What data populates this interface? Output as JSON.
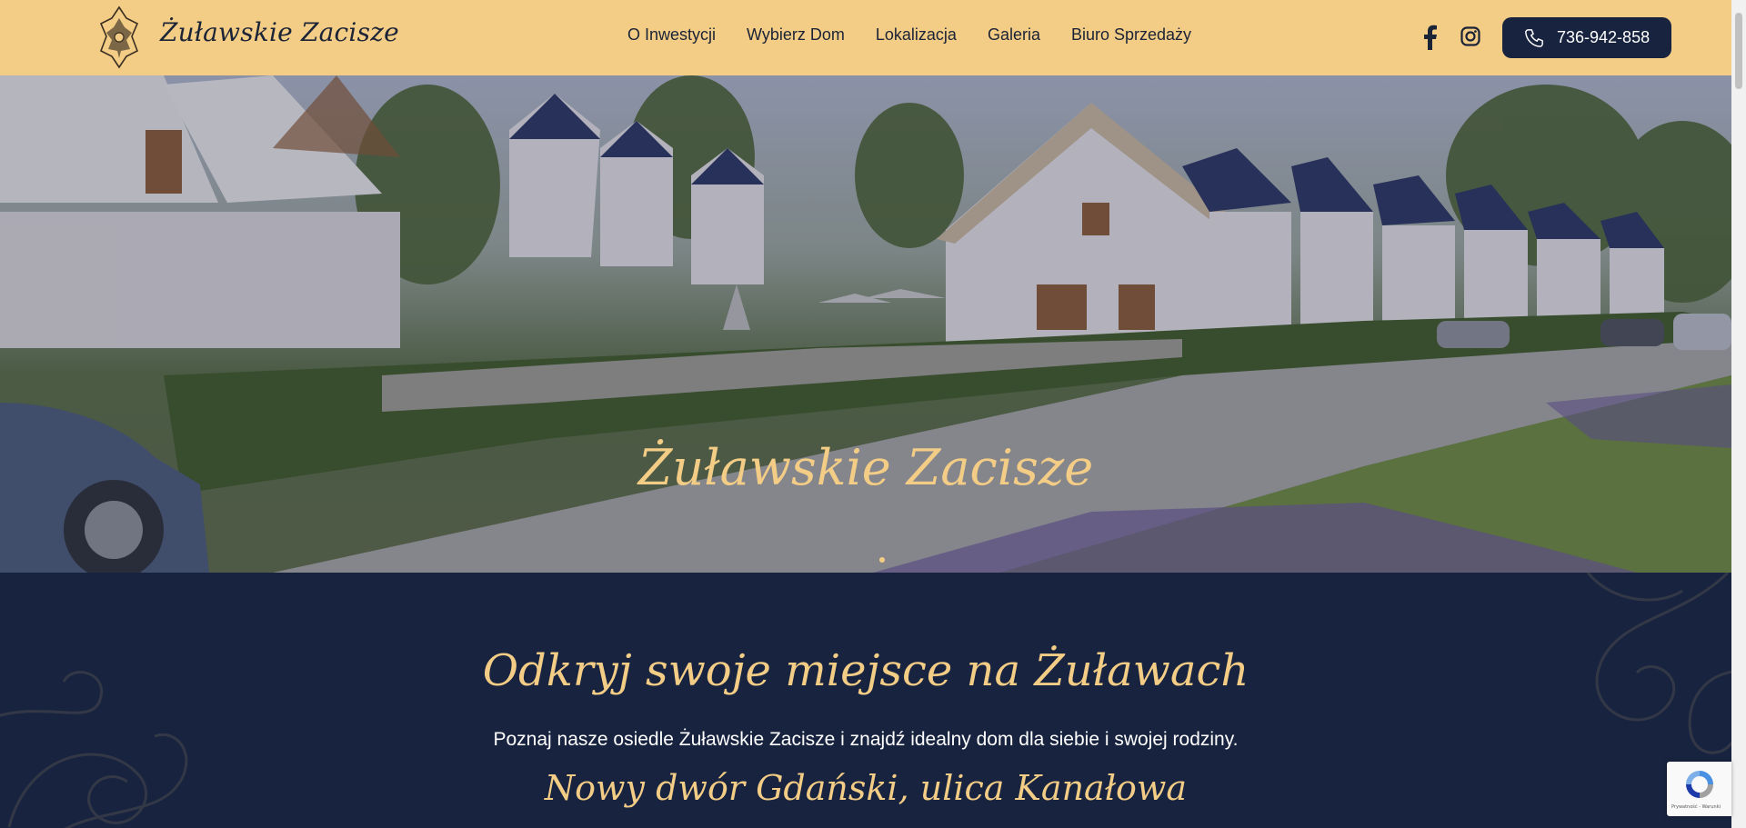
{
  "header": {
    "brand": "Żuławskie Zacisze",
    "nav": [
      "O Inwestycji",
      "Wybierz Dom",
      "Lokalizacja",
      "Galeria",
      "Biuro Sprzedaży"
    ],
    "social": [
      "facebook-icon",
      "instagram-icon"
    ],
    "phone": "736-942-858"
  },
  "hero": {
    "title": "Żuławskie Zacisze",
    "slides_total": 1,
    "slide_active": 1
  },
  "intro": {
    "heading": "Odkryj swoje miejsce na Żuławach",
    "text": "Poznaj nasze osiedle Żuławskie Zacisze i znajdź idealny dom dla siebie i swojej rodziny.",
    "address": "Nowy dwór Gdański, ulica Kanałowa"
  },
  "recaptcha": {
    "footer": "Prywatność - Warunki"
  },
  "colors": {
    "header_bg": "#f3cd86",
    "navy": "#18233f",
    "gold": "#f3cd86"
  }
}
